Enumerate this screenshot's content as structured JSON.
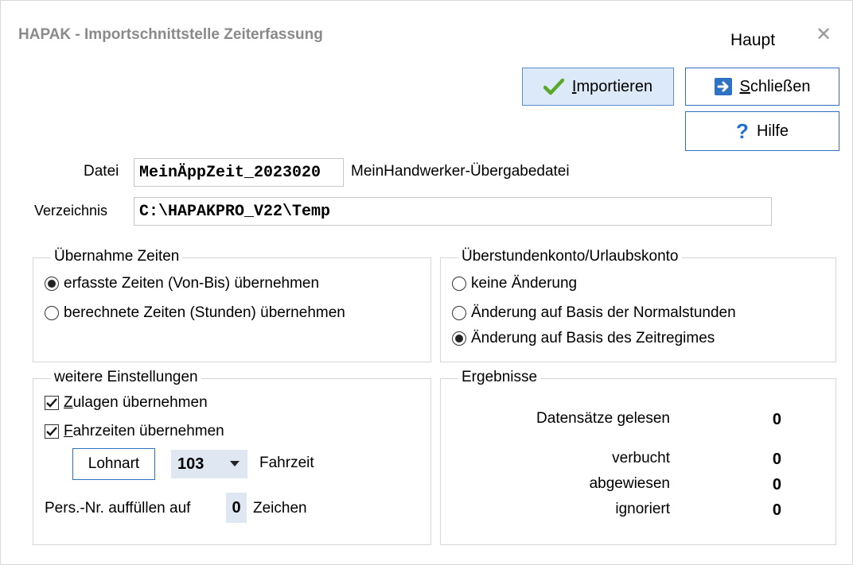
{
  "window": {
    "title": "HAPAK - Importschnittstelle Zeiterfassung",
    "right_label": "Haupt",
    "close_glyph": "✕"
  },
  "buttons": {
    "import_prefix": "I",
    "import_rest": "mportieren",
    "close_prefix": "S",
    "close_rest": "chließen",
    "help": "Hilfe",
    "help_glyph": "?"
  },
  "file": {
    "label": "Datei",
    "value": "MeinÄppZeit_2023020",
    "description": "MeinHandwerker-Übergabedatei"
  },
  "directory": {
    "label": "Verzeichnis",
    "value": "C:\\HAPAKPRO_V22\\Temp"
  },
  "times_group": {
    "legend": "Übernahme Zeiten",
    "options": [
      "erfasste Zeiten (Von-Bis) übernehmen",
      "berechnete Zeiten (Stunden) übernehmen"
    ],
    "selected": 0
  },
  "account_group": {
    "legend": "Überstundenkonto/Urlaubskonto",
    "options": [
      "keine Änderung",
      "Änderung auf Basis der Normalstunden",
      "Änderung auf Basis des Zeitregimes"
    ],
    "selected": 2
  },
  "settings_group": {
    "legend": "weitere Einstellungen",
    "allowances_prefix": "Z",
    "allowances_rest": "ulagen übernehmen",
    "allowances_checked": true,
    "travel_prefix": "F",
    "travel_rest": "ahrzeiten übernehmen",
    "travel_checked": true,
    "wage_type_button": "Lohnart",
    "wage_type_value": "103",
    "wage_type_label": "Fahrzeit",
    "pers_label": "Pers.-Nr. auffüllen auf",
    "pers_value": "0",
    "pers_suffix": "Zeichen"
  },
  "results_group": {
    "legend": "Ergebnisse",
    "rows": [
      {
        "label": "Datensätze gelesen",
        "value": "0"
      },
      {
        "label": "verbucht",
        "value": "0"
      },
      {
        "label": "abgewiesen",
        "value": "0"
      },
      {
        "label": "ignoriert",
        "value": "0"
      }
    ]
  },
  "colors": {
    "accent_border": "#2f6fc6",
    "primary_fill": "#dbe9f8",
    "check_green": "#5aa829",
    "help_blue": "#1f6fcf"
  },
  "icons": {
    "import": "check-icon",
    "close": "exit-arrow-icon",
    "help": "question-icon",
    "dropdown": "caret-down-icon"
  }
}
